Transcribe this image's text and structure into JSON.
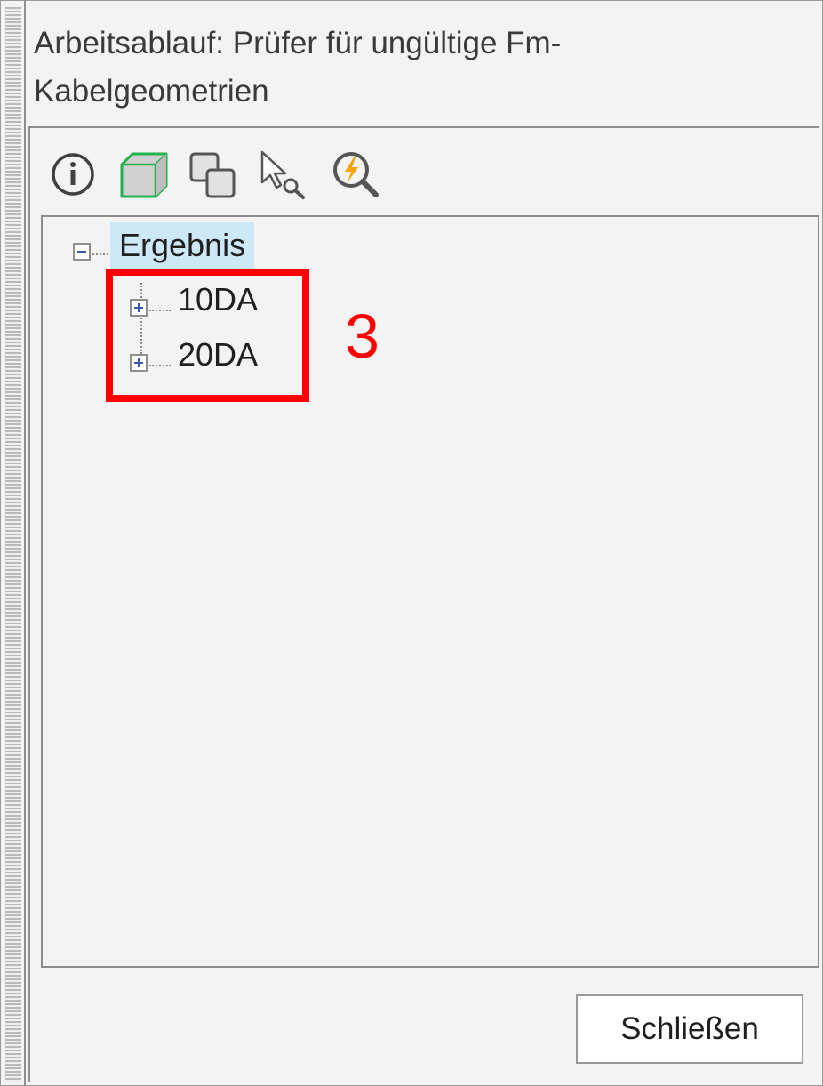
{
  "window": {
    "title_line1": "Arbeitsablauf: Prüfer für ungültige Fm-",
    "title_line2": "Kabelgeometrien"
  },
  "toolbar": {
    "tools": [
      {
        "icon": "info-icon"
      },
      {
        "icon": "3d-box-icon"
      },
      {
        "icon": "overlapping-squares-icon"
      },
      {
        "icon": "cursor-magnifier-icon"
      },
      {
        "icon": "lightning-magnifier-icon"
      }
    ]
  },
  "tree": {
    "root": {
      "label": "Ergebnis",
      "expanded": true,
      "selected": true
    },
    "children": [
      {
        "label": "10DA",
        "expanded": false
      },
      {
        "label": "20DA",
        "expanded": false
      }
    ]
  },
  "annotation": {
    "label": "3",
    "color": "#ff0000"
  },
  "footer": {
    "close_label": "Schließen"
  },
  "colors": {
    "selection": "#cde8f7",
    "accent_green": "#22b14c",
    "annotation_red": "#ff0000"
  }
}
